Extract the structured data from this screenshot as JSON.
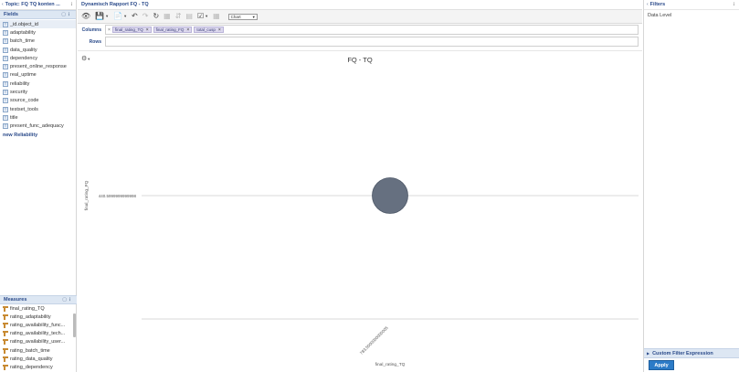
{
  "topic": {
    "title": "Topic: FQ TQ konten ..."
  },
  "fields": {
    "header": "Fields",
    "items": [
      {
        "label": "_id.object_id",
        "selected": true
      },
      {
        "label": "adaptability"
      },
      {
        "label": "batch_time"
      },
      {
        "label": "data_quality"
      },
      {
        "label": "dependency"
      },
      {
        "label": "present_online_response"
      },
      {
        "label": "real_uptime"
      },
      {
        "label": "reliability"
      },
      {
        "label": "security"
      },
      {
        "label": "source_code"
      },
      {
        "label": "testset_tools"
      },
      {
        "label": "title"
      },
      {
        "label": "present_func_adequacy"
      },
      {
        "label": "new Reliability",
        "strong": true
      }
    ]
  },
  "measures": {
    "header": "Measures",
    "items": [
      "final_rating_TQ",
      "rating_adaptability",
      "rating_availability_func...",
      "rating_availability_tech...",
      "rating_availability_user...",
      "rating_batch_time",
      "rating_data_quality",
      "rating_dependency"
    ]
  },
  "report": {
    "title": "Dynamisch Rapport FQ - TQ"
  },
  "toolbar": {
    "icons": [
      "eye-icon",
      "save-icon",
      "export-icon",
      "undo-icon",
      "redo-icon",
      "refresh-icon",
      "drill-icon",
      "swap-icon",
      "grid-icon",
      "chart-options-icon",
      "table-icon"
    ],
    "chart_type": "Chart"
  },
  "shelves": {
    "columns_label": "Columns",
    "rows_label": "Rows",
    "columns_lead": "×",
    "columns": [
      "final_rating_TQ",
      "final_rating_FQ",
      "total_cusp"
    ],
    "rows": []
  },
  "chart_data": {
    "type": "scatter",
    "title": "FQ - TQ",
    "xlabel": "final_rating_TQ",
    "ylabel": "final_rating_FQ",
    "x_tick_labels": [
      "783.5000000000005"
    ],
    "y_tick_labels": [
      "440.5999999999998"
    ],
    "points": [
      {
        "x": 783.5000000000005,
        "y": 440.5999999999998,
        "size_series": "total_cusp"
      }
    ],
    "grid": true,
    "colors": {
      "point": "#667080",
      "point_stroke": "#4e5868",
      "gridline": "#d8d8d8"
    }
  },
  "filters": {
    "header": "Filters",
    "data_level": "Data Level",
    "custom_filter": "Custom Filter Expression",
    "apply_label": "Apply"
  }
}
